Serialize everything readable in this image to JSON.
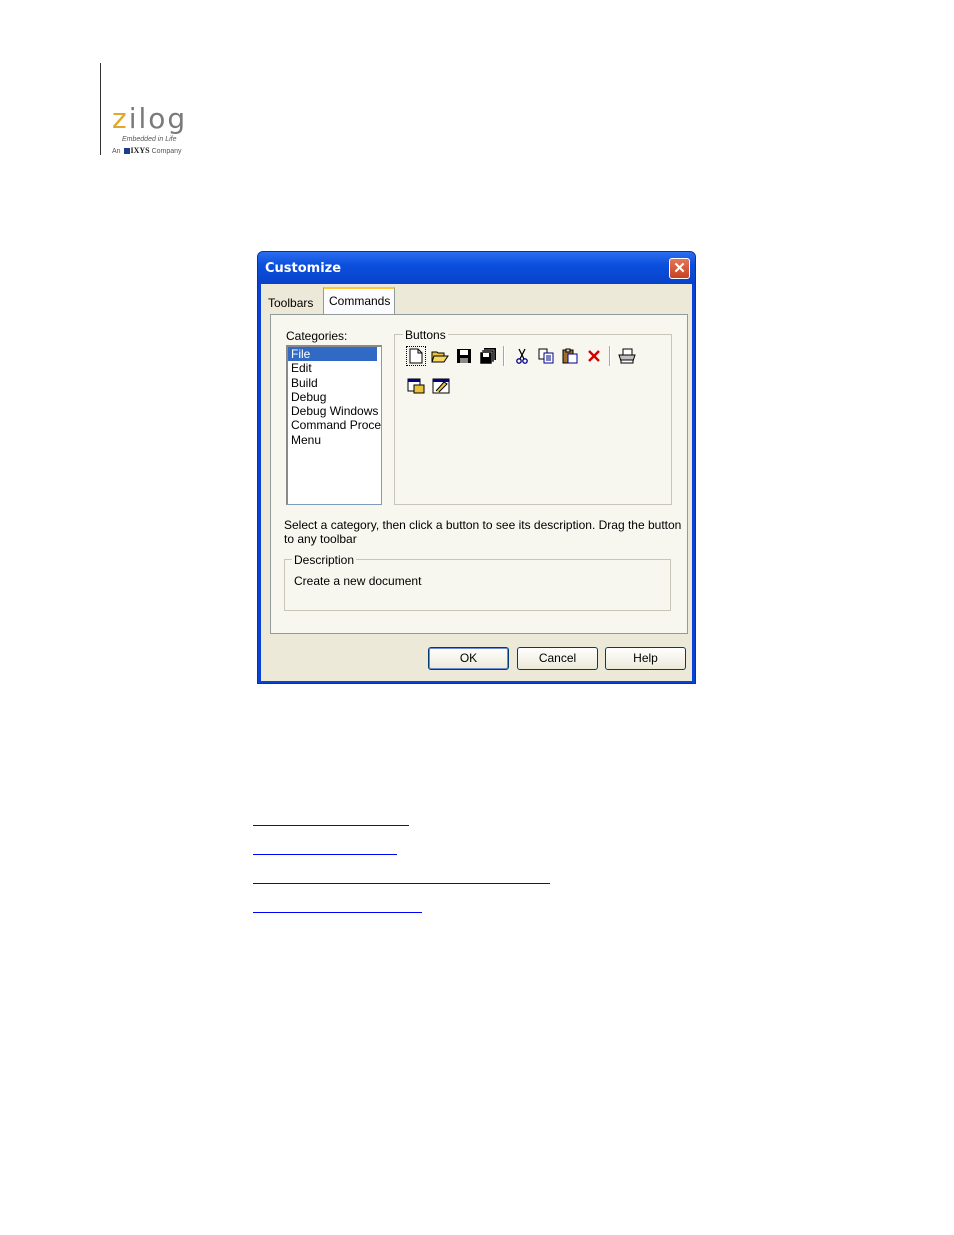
{
  "logo": {
    "wordmark_z": "z",
    "wordmark_rest": "ilog",
    "tagline": "Embedded in Life",
    "company_prefix": "An",
    "company_name": "IXYS",
    "company_suffix": "Company"
  },
  "dialog": {
    "title": "Customize",
    "close_glyph": "✕",
    "tabs": [
      {
        "label": "Toolbars",
        "active": false
      },
      {
        "label": "Commands",
        "active": true
      }
    ],
    "categories_label": "Categories:",
    "categories": [
      "File",
      "Edit",
      "Build",
      "Debug",
      "Debug Windows",
      "Command Proces",
      "Menu"
    ],
    "selected_category": "File",
    "buttons_label": "Buttons",
    "toolbar_icons": [
      "new-document-icon",
      "open-folder-icon",
      "save-icon",
      "save-all-icon",
      "cut-icon",
      "copy-icon",
      "paste-icon",
      "delete-icon",
      "print-icon",
      "new-project-icon",
      "open-project-icon"
    ],
    "hint": "Select a category, then click a button to see its description. Drag the button to any toolbar",
    "description_label": "Description",
    "description_text": "Create a new document",
    "ok_label": "OK",
    "cancel_label": "Cancel",
    "help_label": "Help"
  },
  "colors": {
    "title_bar": "#0842c9",
    "dialog_face": "#ece9d8",
    "selection": "#316ac5",
    "link": "#0000ff",
    "logo_accent": "#e3a52b"
  }
}
